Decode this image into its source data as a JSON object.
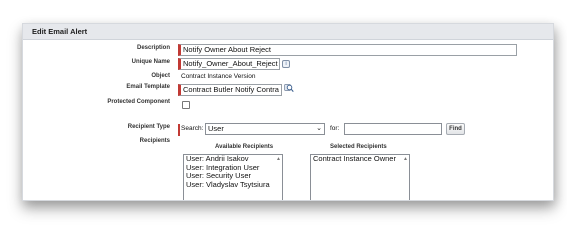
{
  "panel": {
    "title": "Edit Email Alert"
  },
  "fields": {
    "description": {
      "label": "Description",
      "value": "Notify Owner About Reject"
    },
    "unique_name": {
      "label": "Unique Name",
      "value": "Notify_Owner_About_Reject",
      "info_icon": "i"
    },
    "object": {
      "label": "Object",
      "value": "Contract Instance Version"
    },
    "email_template": {
      "label": "Email Template",
      "value": "Contract Butler Notify Contra"
    },
    "protected_component": {
      "label": "Protected Component",
      "checked": false
    }
  },
  "recipient_type": {
    "label": "Recipient Type",
    "search_label": "Search:",
    "selected": "User",
    "for_label": "for:",
    "for_value": "",
    "find_button": "Find"
  },
  "recipients": {
    "label": "Recipients",
    "available_title": "Available Recipients",
    "selected_title": "Selected Recipients",
    "available": [
      "User: Andrii Isakov",
      "User: Integration User",
      "User: Security User",
      "User: Vladyslav Tsytsiura"
    ],
    "selected": [
      "Contract Instance Owner"
    ]
  },
  "colors": {
    "required_marker": "#c23934",
    "header_bg": "#e6e8ec"
  },
  "icons": {
    "info": "info-icon",
    "lookup": "lookup-icon",
    "dropdown": "chevron-down-icon",
    "scroll": "scroll-up-icon"
  }
}
